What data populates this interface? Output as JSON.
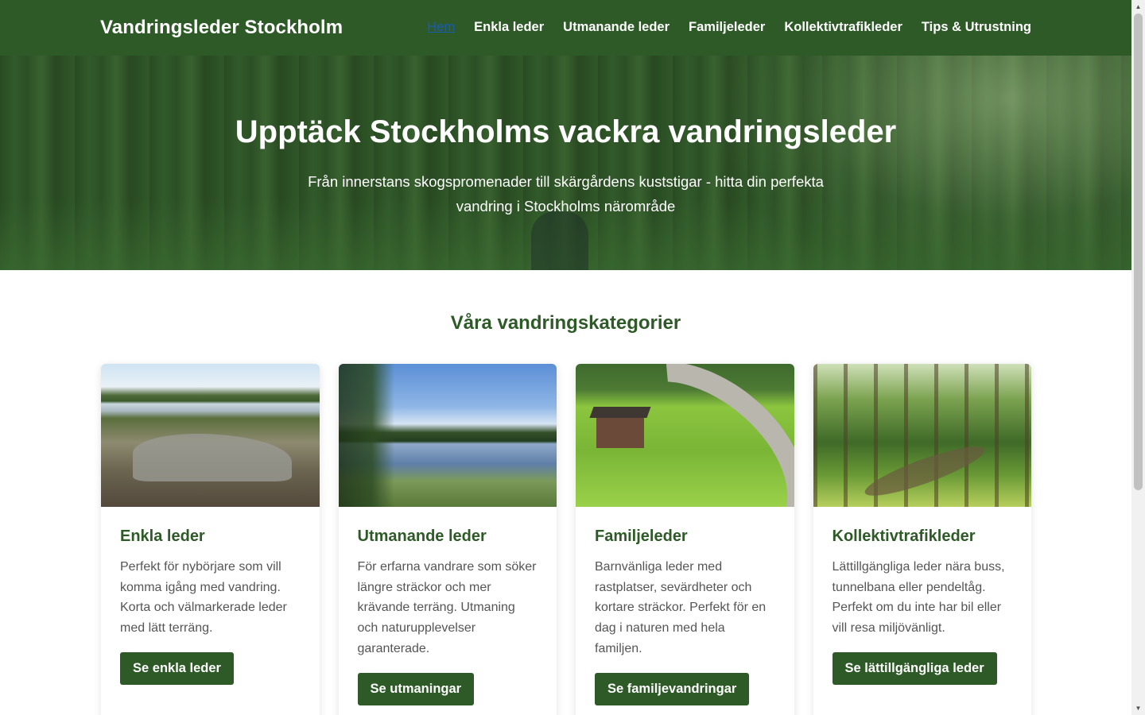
{
  "header": {
    "brand": "Vandringsleder Stockholm",
    "nav": [
      {
        "label": "Hem"
      },
      {
        "label": "Enkla leder"
      },
      {
        "label": "Utmanande leder"
      },
      {
        "label": "Familjeleder"
      },
      {
        "label": "Kollektivtrafikleder"
      },
      {
        "label": "Tips & Utrustning"
      }
    ]
  },
  "hero": {
    "title": "Upptäck Stockholms vackra vandringsleder",
    "subtitle": "Från innerstans skogspromenader till skärgårdens kuststigar - hitta din perfekta vandring i Stockholms närområde"
  },
  "section": {
    "title": "Våra vandringskategorier"
  },
  "cards": [
    {
      "title": "Enkla leder",
      "text": "Perfekt för nybörjare som vill komma igång med vandring. Korta och välmarkerade leder med lätt terräng.",
      "button": "Se enkla leder"
    },
    {
      "title": "Utmanande leder",
      "text": "För erfarna vandrare som söker längre sträckor och mer krävande terräng. Utmaning och naturupplevelser garanterade.",
      "button": "Se utmaningar"
    },
    {
      "title": "Familjeleder",
      "text": "Barnvänliga leder med rastplatser, sevärdheter och kortare sträckor. Perfekt för en dag i naturen med hela familjen.",
      "button": "Se familjevandringar"
    },
    {
      "title": "Kollektivtrafikleder",
      "text": "Lättillgängliga leder nära buss, tunnelbana eller pendeltåg. Perfekt om du inte har bil eller vill resa miljövänligt.",
      "button": "Se lättillgängliga leder"
    }
  ],
  "scrollbar": {
    "up_icon": "▲",
    "down_icon": "▼"
  },
  "colors": {
    "primary": "#2d5a27",
    "active_link": "#1a5bb5",
    "text": "#555555"
  }
}
